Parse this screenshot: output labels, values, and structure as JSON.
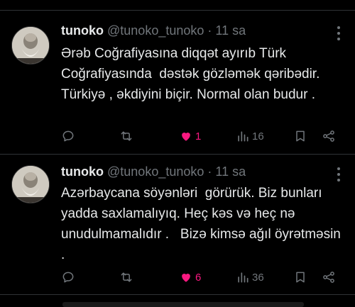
{
  "tweets": [
    {
      "name": "tunoko",
      "handle": "@tunoko_tunoko",
      "dot": "·",
      "time": "11 sa",
      "text": "Ərəb Coğrafiyasına diqqət ayırıb Türk Coğrafiyasında  dəstək gözləmək qəribədir. Türkiyə , əkdiyini biçir. Normal olan budur .",
      "likes": "1",
      "views": "16"
    },
    {
      "name": "tunoko",
      "handle": "@tunoko_tunoko",
      "dot": "·",
      "time": "11 sa",
      "text": "Azərbaycana söyənləri  görürük. Biz bunları yadda saxlamalıyıq. Heç kəs və heç nə unudulmamalıdır .   Bizə kimsə ağıl öyrətməsin .",
      "likes": "6",
      "views": "36"
    }
  ],
  "icons": {
    "reply": "reply-icon",
    "retweet": "retweet-icon",
    "like": "heart-icon",
    "views": "views-icon",
    "bookmark": "bookmark-icon",
    "share": "share-icon"
  },
  "colors": {
    "background": "#000000",
    "text": "#e7e9ea",
    "muted": "#71767b",
    "like": "#f91880",
    "divider": "#2f3336"
  }
}
